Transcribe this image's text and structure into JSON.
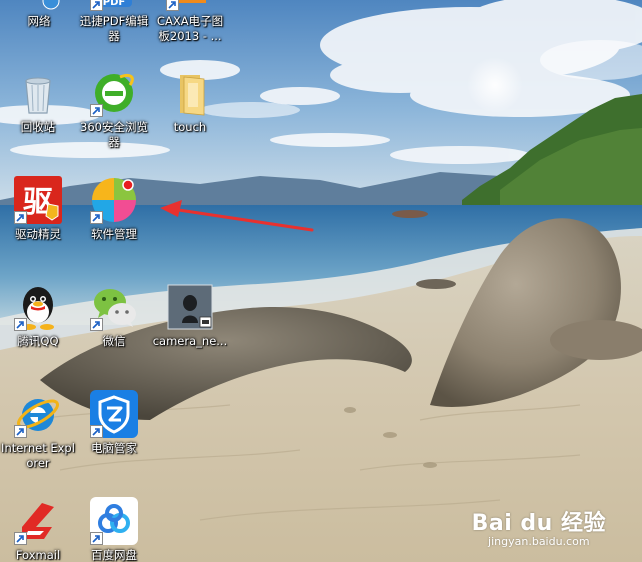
{
  "desktop": {
    "icons": [
      {
        "label": "网络",
        "icon": "network-icon"
      },
      {
        "label": "迅捷PDF编辑器",
        "icon": "pdf-editor-icon",
        "badge": "PDF"
      },
      {
        "label": "CAXA电子图板2013 - ...",
        "icon": "caxa-icon"
      },
      {
        "label": "回收站",
        "icon": "recycle-bin-icon"
      },
      {
        "label": "360安全浏览器",
        "icon": "360-browser-icon"
      },
      {
        "label": "touch",
        "icon": "folder-icon"
      },
      {
        "label": "驱动精灵",
        "icon": "driver-genius-icon",
        "glyph": "驱"
      },
      {
        "label": "软件管理",
        "icon": "software-manager-icon"
      },
      {
        "label": "腾讯QQ",
        "icon": "qq-icon"
      },
      {
        "label": "微信",
        "icon": "wechat-icon"
      },
      {
        "label": "camera_ne...",
        "icon": "camera-file-icon"
      },
      {
        "label": "Internet Explorer",
        "icon": "internet-explorer-icon"
      },
      {
        "label": "电脑管家",
        "icon": "pc-manager-icon"
      },
      {
        "label": "Foxmail",
        "icon": "foxmail-icon"
      },
      {
        "label": "百度网盘",
        "icon": "baidu-netdisk-icon"
      }
    ]
  },
  "annotation": {
    "color": "#e8312f",
    "points_to": "软件管理"
  },
  "watermark": {
    "brand": "Bai du 经验",
    "site": "jingyan.baidu.com"
  },
  "colors": {
    "sky": "#6f9cc9",
    "sea": "#3a7fb1",
    "sand": "#d8cdb6",
    "rock": "#8a7e6c",
    "hill": "#3d6e2c"
  }
}
